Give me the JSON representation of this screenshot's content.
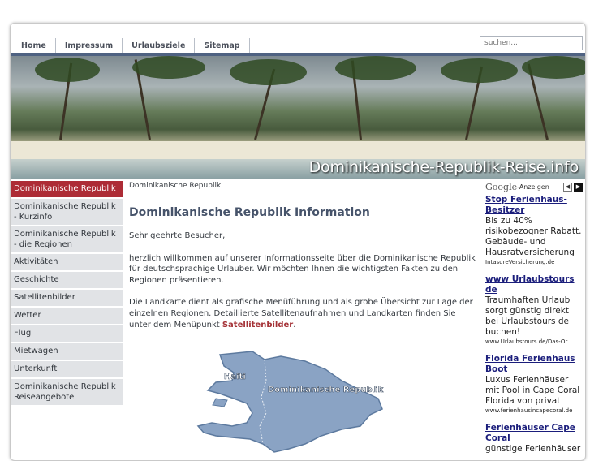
{
  "nav": {
    "links": [
      "Home",
      "Impressum",
      "Urlaubsziele",
      "Sitemap"
    ],
    "search_placeholder": "suchen..."
  },
  "banner": {
    "title": "Dominikanische-Republik-Reise.info"
  },
  "sidebar": {
    "items": [
      {
        "label": "Dominikanische Republik",
        "active": true
      },
      {
        "label": "Dominikanische Republik - Kurzinfo"
      },
      {
        "label": "Dominikanische Republik - die Regionen"
      },
      {
        "label": "Aktivitäten"
      },
      {
        "label": "Geschichte"
      },
      {
        "label": "Satellitenbilder"
      },
      {
        "label": "Wetter"
      },
      {
        "label": "Flug"
      },
      {
        "label": "Mietwagen"
      },
      {
        "label": "Unterkunft"
      },
      {
        "label": "Dominikanische Republik Reiseangebote"
      }
    ]
  },
  "main": {
    "breadcrumb": "Dominikanische Republik",
    "heading": "Dominikanische Republik Information",
    "greeting": "Sehr geehrte Besucher,",
    "para1": "herzlich willkommen auf unserer Informationsseite über die Dominikanische Republik für deutschsprachige Urlauber. Wir möchten Ihnen die wichtigsten Fakten zu den Regionen präsentieren.",
    "para2_before": "Die Landkarte dient als grafische Menüführung und als grobe Übersicht zur Lage der einzelnen Regionen. Detaillierte Satellitenaufnahmen und Landkarten finden Sie unter dem Menüpunkt ",
    "para2_link": "Satellitenbilder",
    "para2_after": ".",
    "map": {
      "label_haiti": "Haiti",
      "label_dr": "Dominikanische Republik"
    }
  },
  "ads": {
    "brand": "Google",
    "label": "-Anzeigen",
    "items": [
      {
        "title": "Stop Ferienhaus-Besitzer",
        "desc": "Bis zu 40% risikobezogner Rabatt. Gebäude- und Hausratversicherung",
        "url": "IntasureVersicherung.de"
      },
      {
        "title": "www Urlaubstours de",
        "desc": "Traumhaften Urlaub sorgt günstig direkt bei Urlaubstours de buchen!",
        "url": "www.Urlaubstours.de/Das-Or..."
      },
      {
        "title": "Florida Ferienhaus Boot",
        "desc": "Luxus Ferienhäuser mit Pool in Cape Coral Florida von privat",
        "url": "www.ferienhausincapecoral.de"
      },
      {
        "title": "Ferienhäuser Cape Coral",
        "desc": "günstige Ferienhäuser",
        "url": ""
      }
    ]
  }
}
